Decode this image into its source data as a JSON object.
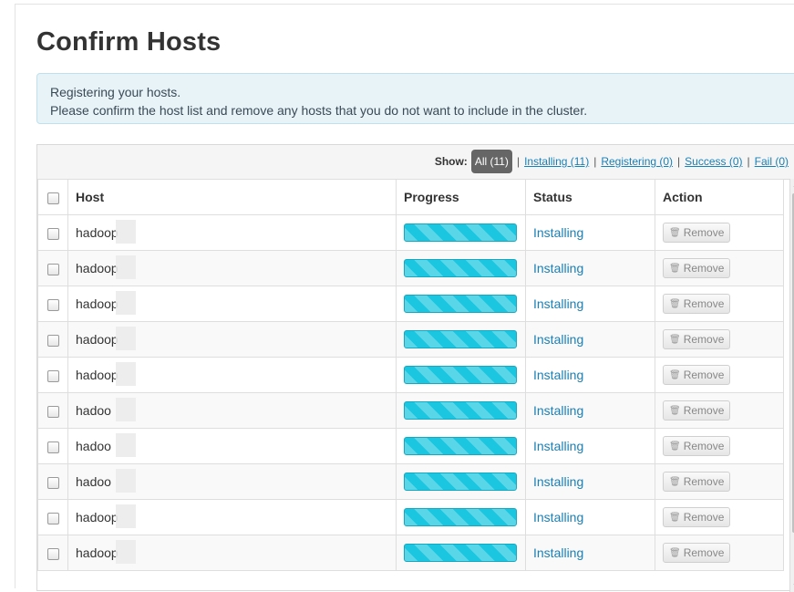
{
  "page": {
    "title": "Confirm Hosts"
  },
  "alert": {
    "line1": "Registering your hosts.",
    "line2": "Please confirm the host list and remove any hosts that you do not want to include in the cluster."
  },
  "filters": {
    "show_label": "Show:",
    "all": "All (11)",
    "installing": "Installing (11)",
    "registering": "Registering (0)",
    "success": "Success (0)",
    "fail": "Fail (0)",
    "separator": "|"
  },
  "table": {
    "headers": {
      "host": "Host",
      "progress": "Progress",
      "status": "Status",
      "action": "Action"
    },
    "rows": [
      {
        "host": "hadoop",
        "progress": 1.0,
        "status": "Installing",
        "action": "Remove"
      },
      {
        "host": "hadoop",
        "progress": 1.0,
        "status": "Installing",
        "action": "Remove"
      },
      {
        "host": "hadoop",
        "progress": 1.0,
        "status": "Installing",
        "action": "Remove"
      },
      {
        "host": "hadoop",
        "progress": 1.0,
        "status": "Installing",
        "action": "Remove"
      },
      {
        "host": "hadoop",
        "progress": 1.0,
        "status": "Installing",
        "action": "Remove"
      },
      {
        "host": "hadoo",
        "progress": 1.0,
        "status": "Installing",
        "action": "Remove"
      },
      {
        "host": "hadoo",
        "progress": 1.0,
        "status": "Installing",
        "action": "Remove"
      },
      {
        "host": "hadoo",
        "progress": 1.0,
        "status": "Installing",
        "action": "Remove"
      },
      {
        "host": "hadoop",
        "progress": 1.0,
        "status": "Installing",
        "action": "Remove"
      },
      {
        "host": "hadoop",
        "progress": 1.0,
        "status": "Installing",
        "action": "Remove"
      }
    ]
  },
  "icons": {
    "remove": "trash-icon",
    "checkbox": "checkbox"
  },
  "colors": {
    "progress": "#1bc6e0",
    "link": "#1a7fb5",
    "alert_bg": "#e8f3f8",
    "pill_bg": "#666666"
  }
}
